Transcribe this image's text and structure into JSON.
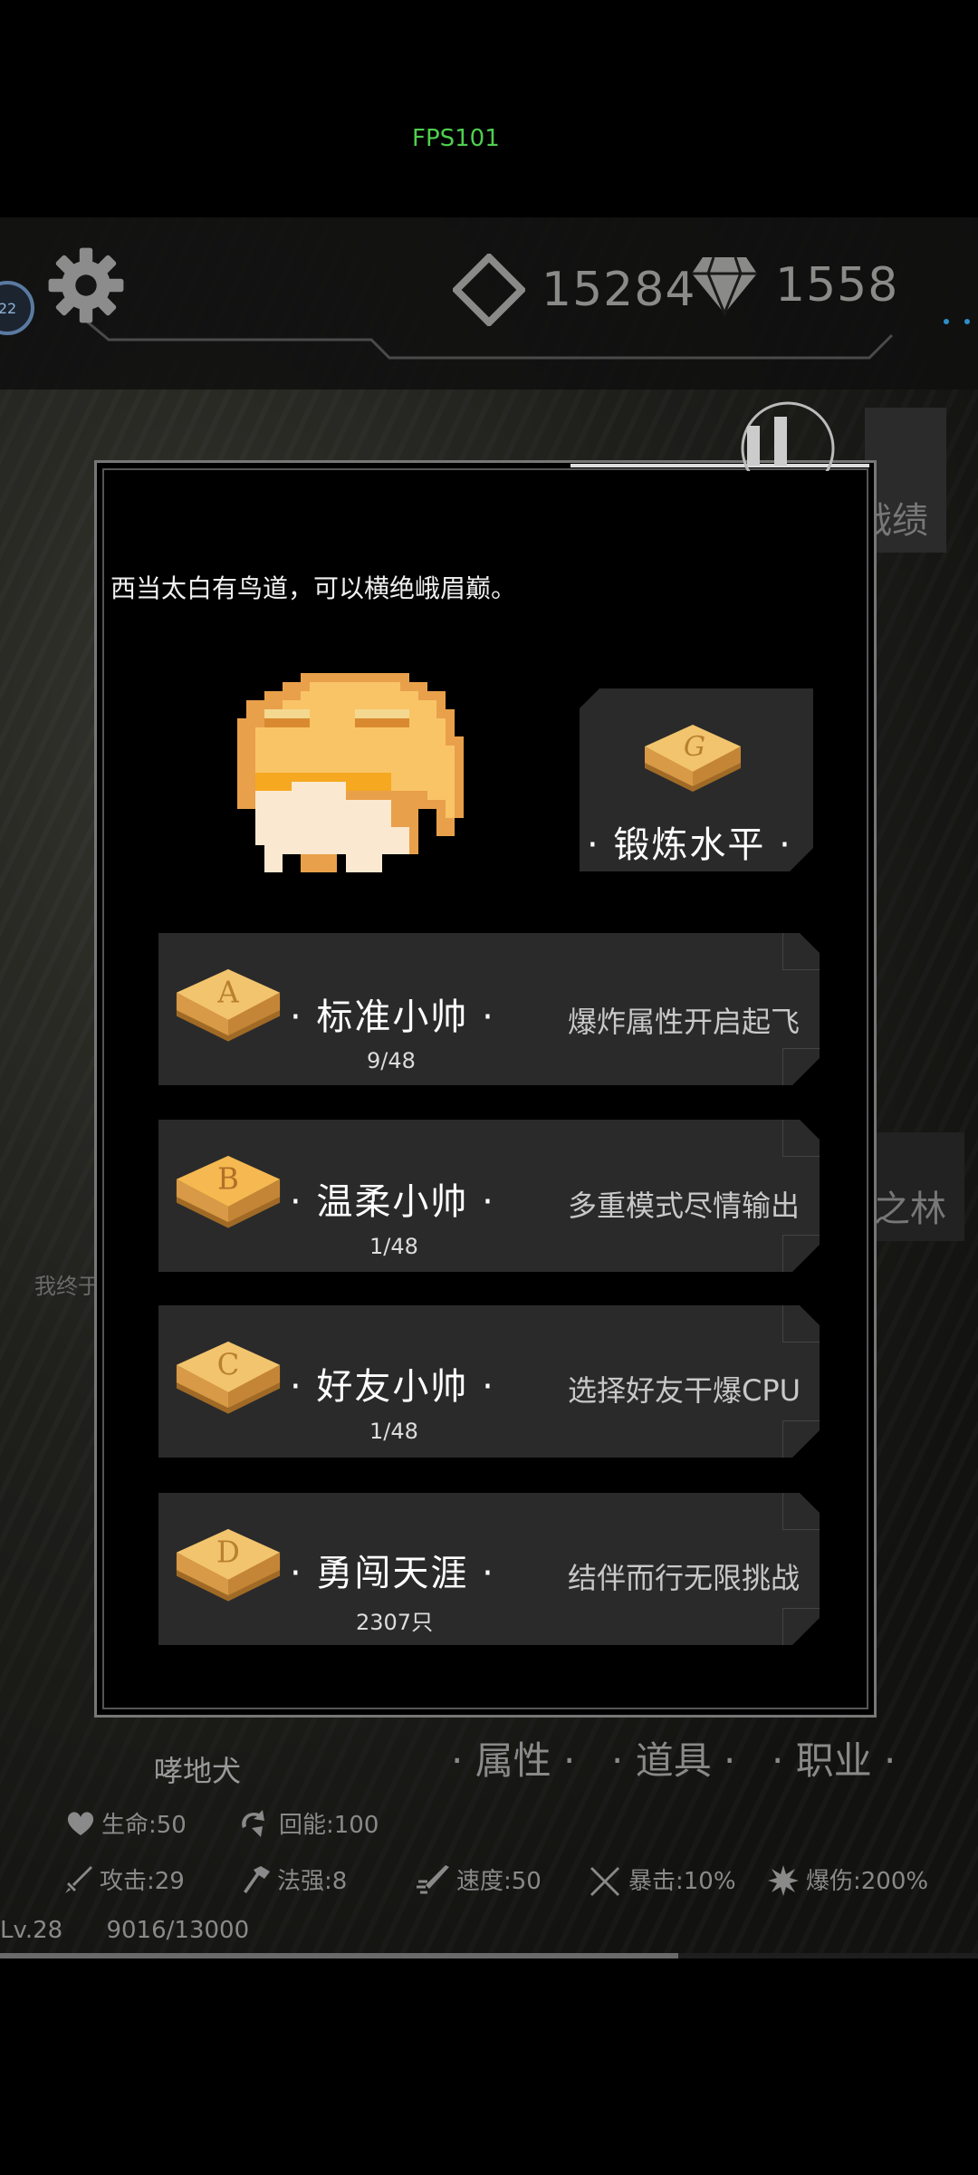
{
  "status": {
    "fps": "FPS101"
  },
  "header": {
    "avatar_level": "22",
    "currency": {
      "crystal": "15284",
      "diamond": "1558"
    }
  },
  "side_tabs": {
    "right_top": "战绩",
    "right_mid": "之林"
  },
  "left_hint": "我终于",
  "modal": {
    "quote": "西当太白有鸟道，可以横绝峨眉巅。",
    "forge": {
      "title": "· 锻炼水平 ·",
      "plate_letter": "G"
    },
    "modes": [
      {
        "letter": "A",
        "title": "· 标准小帅 ·",
        "sub": "9/48",
        "desc": "爆炸属性开启起飞"
      },
      {
        "letter": "B",
        "title": "· 温柔小帅 ·",
        "sub": "1/48",
        "desc": "多重模式尽情输出"
      },
      {
        "letter": "C",
        "title": "· 好友小帅 ·",
        "sub": "1/48",
        "desc": "选择好友干爆CPU"
      },
      {
        "letter": "D",
        "title": "· 勇闯天涯 ·",
        "sub": "2307只",
        "desc": "结伴而行无限挑战"
      }
    ]
  },
  "pet": {
    "name": "哮地犬"
  },
  "bottom_tabs": {
    "attr": "· 属性 ·",
    "items": "· 道具 ·",
    "job": "· 职业 ·"
  },
  "stats": {
    "hp": "生命:50",
    "regen": "回能:100",
    "atk": "攻击:29",
    "magic": "法强:8",
    "speed": "速度:50",
    "crit": "暴击:10%",
    "critdmg": "爆伤:200%"
  },
  "level": {
    "lv": "Lv.28",
    "xp": "9016/13000",
    "progress": 0.6935
  },
  "colors": {
    "gold": "#f2c46d",
    "gold_dark": "#c98c3a",
    "accent_green": "#4fcf4f"
  }
}
